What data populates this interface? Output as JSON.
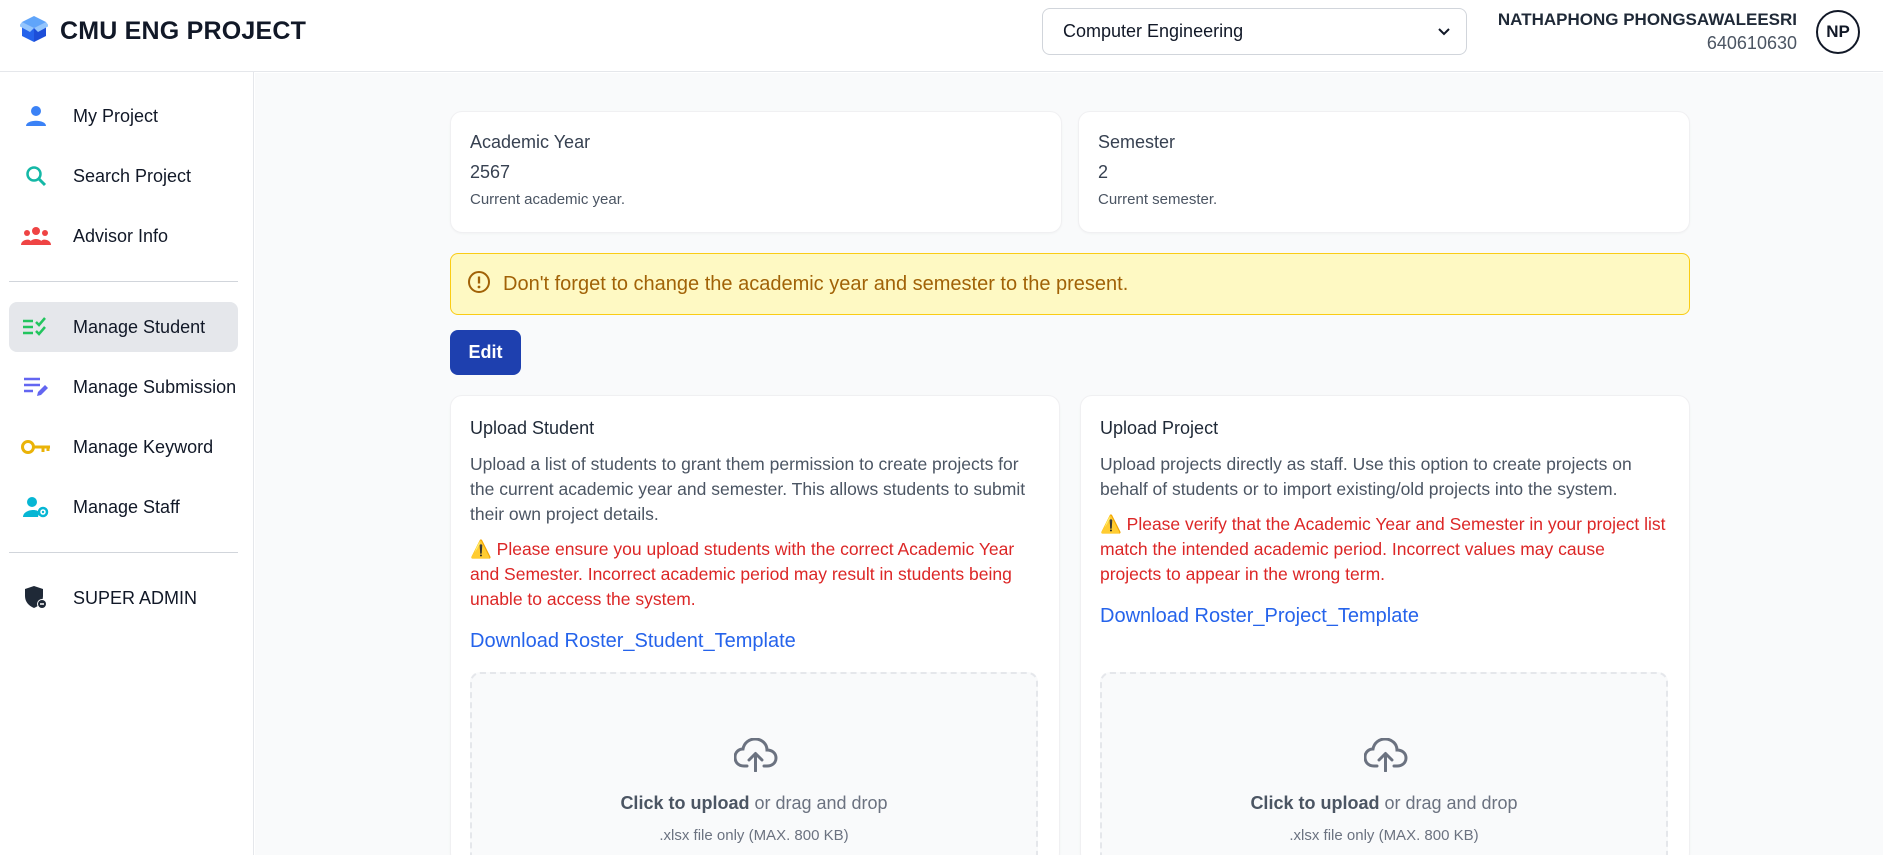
{
  "header": {
    "brand_title": "CMU ENG PROJECT",
    "department_selected": "Computer Engineering",
    "user_name": "NATHAPHONG PHONGSAWALEESRI",
    "user_id": "640610630",
    "avatar_initials": "NP"
  },
  "sidebar": {
    "items": [
      {
        "label": "My Project",
        "icon": "user-icon"
      },
      {
        "label": "Search Project",
        "icon": "search-icon"
      },
      {
        "label": "Advisor Info",
        "icon": "users-group-icon"
      },
      {
        "label": "Manage Student",
        "icon": "checklist-icon",
        "active": true
      },
      {
        "label": "Manage Submission",
        "icon": "edit-list-icon"
      },
      {
        "label": "Manage Keyword",
        "icon": "key-icon"
      },
      {
        "label": "Manage Staff",
        "icon": "user-gear-icon"
      },
      {
        "label": "SUPER ADMIN",
        "icon": "shield-icon"
      }
    ]
  },
  "academic_year": {
    "title": "Academic Year",
    "value": "2567",
    "description": "Current academic year."
  },
  "semester": {
    "title": "Semester",
    "value": "2",
    "description": "Current semester."
  },
  "alert": {
    "text": "Don't forget to change the academic year and semester to the present."
  },
  "edit_label": "Edit",
  "upload_student": {
    "title": "Upload Student",
    "description": "Upload a list of students to grant them permission to create projects for the current academic year and semester. This allows students to submit their own project details.",
    "warning": "⚠️ Please ensure you upload students with the correct Academic Year and Semester. Incorrect academic period may result in students being unable to access the system.",
    "link": "Download Roster_Student_Template",
    "click_text": "Click to upload",
    "drag_text": " or drag and drop",
    "note": ".xlsx file only (MAX. 800 KB)"
  },
  "upload_project": {
    "title": "Upload Project",
    "description": "Upload projects directly as staff. Use this option to create projects on behalf of students or to import existing/old projects into the system.",
    "warning": "⚠️ Please verify that the Academic Year and Semester in your project list match the intended academic period. Incorrect values may cause projects to appear in the wrong term.",
    "link": "Download Roster_Project_Template",
    "click_text": "Click to upload",
    "drag_text": " or drag and drop",
    "note": ".xlsx file only (MAX. 800 KB)"
  },
  "colors": {
    "primary": "#1e40af",
    "warning_bg": "#fef9c3",
    "warning_text": "#a16207",
    "danger": "#dc2626",
    "link": "#2563eb"
  }
}
